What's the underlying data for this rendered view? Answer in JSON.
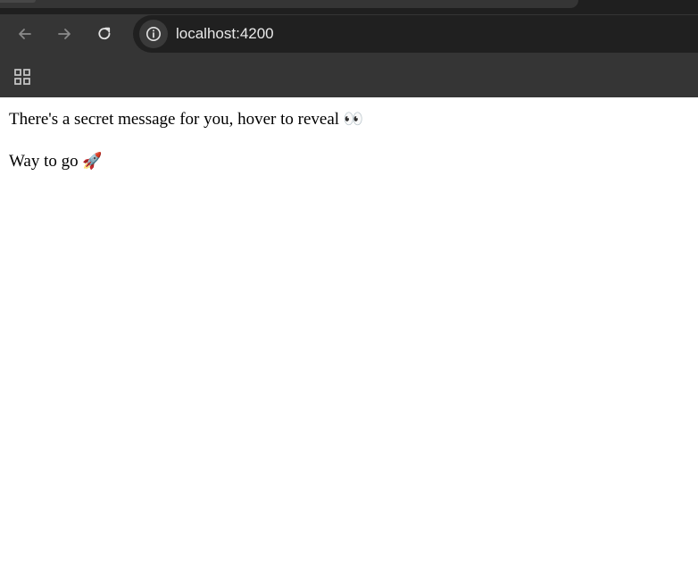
{
  "browser": {
    "url": "localhost:4200",
    "icons": {
      "back": "arrow-left-icon",
      "forward": "arrow-right-icon",
      "reload": "reload-icon",
      "site_info": "info-circle-icon",
      "apps": "apps-grid-icon"
    }
  },
  "page": {
    "secret_prompt": "There's a secret message for you, hover to reveal",
    "secret_prompt_emoji": "👀",
    "revealed_message": "Way to go",
    "revealed_message_emoji": "🚀"
  },
  "colors": {
    "chrome_dark": "#353535",
    "tabstrip": "#1f1f1f",
    "omnibox": "#202020",
    "page_background": "#ffffff",
    "text": "#000000"
  }
}
